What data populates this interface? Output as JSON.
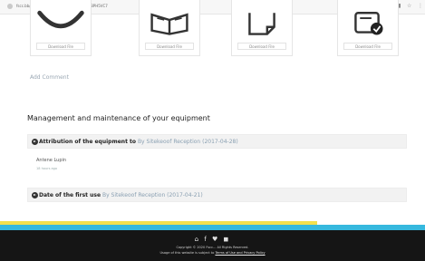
{
  "browser": {
    "url": "fscc.bb/eraw.prolcou-nMMaYG2_Z1HJG7S8PH5VC7",
    "icon_reader": "book-icon",
    "icon_star": "star-icon",
    "icon_menu": "menu-icon"
  },
  "documents": [
    {
      "icon": "phone-icon",
      "download_label": "Download File"
    },
    {
      "icon": "book-icon",
      "download_label": "Download File"
    },
    {
      "icon": "note-icon",
      "download_label": "Download File"
    },
    {
      "icon": "checklist-icon",
      "download_label": "Download File"
    }
  ],
  "add_comment": "Add Comment",
  "section": {
    "title": "Management and maintenance of your equipment"
  },
  "panels": [
    {
      "title": "Attribution of the equipment to",
      "meta": "By Sitekeoof Reception (2017-04-28)"
    },
    {
      "title": "Date of the first use",
      "meta": "By Sitekeoof Reception (2017-04-21)"
    }
  ],
  "entry": {
    "name": "Antene Lupin",
    "time": "18 hours ago"
  },
  "footer": {
    "social": "☎ ◼ ♥ ◼",
    "copyright": "Copyright © 2020 Fscc... All Rights Reserved.",
    "usage_prefix": "Usage of this website is subject to ",
    "terms_link": "Terms of Use and Privacy Policy",
    "stripes": {
      "yellow": "#f4e04d",
      "cyan": "#36b8de"
    }
  }
}
